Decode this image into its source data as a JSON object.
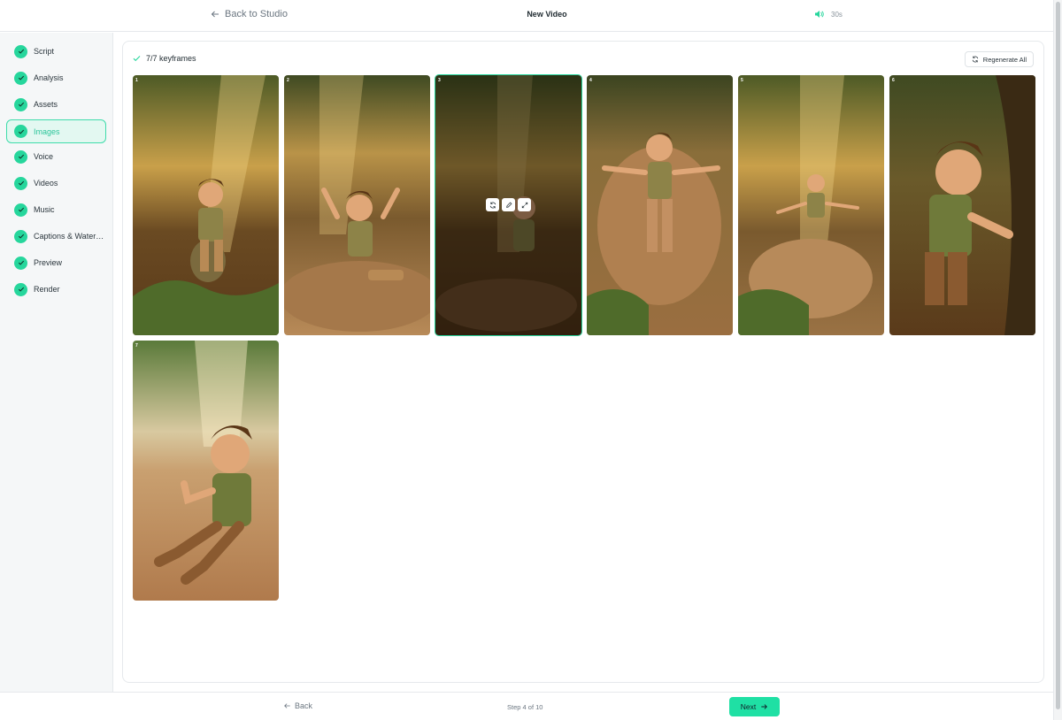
{
  "header": {
    "back_label": "Back to Studio",
    "title": "New Video",
    "duration": "30s",
    "speaker_icon": "speaker-icon"
  },
  "sidebar": {
    "steps": [
      {
        "label": "Script",
        "done": true
      },
      {
        "label": "Analysis",
        "done": true
      },
      {
        "label": "Assets",
        "done": true
      },
      {
        "label": "Images",
        "done": true,
        "active": true
      },
      {
        "label": "Voice",
        "done": true
      },
      {
        "label": "Videos",
        "done": true
      },
      {
        "label": "Music",
        "done": true
      },
      {
        "label": "Captions & Water…",
        "done": true
      },
      {
        "label": "Preview",
        "done": true
      },
      {
        "label": "Render",
        "done": true
      }
    ]
  },
  "main": {
    "keyframes_label": "7/7 keyframes",
    "regenerate_all_label": "Regenerate All",
    "frames": [
      {
        "number": "1"
      },
      {
        "number": "2"
      },
      {
        "number": "3",
        "selected": true
      },
      {
        "number": "4"
      },
      {
        "number": "5"
      },
      {
        "number": "6"
      },
      {
        "number": "7"
      }
    ],
    "frame_tools": [
      "refresh-icon",
      "edit-icon",
      "expand-icon"
    ]
  },
  "footer": {
    "back_label": "Back",
    "step_label": "Step 4 of 10",
    "next_label": "Next"
  },
  "colors": {
    "accent": "#26d69c",
    "next_button": "#1fe0a4",
    "active_bg": "#e3f8f1"
  }
}
